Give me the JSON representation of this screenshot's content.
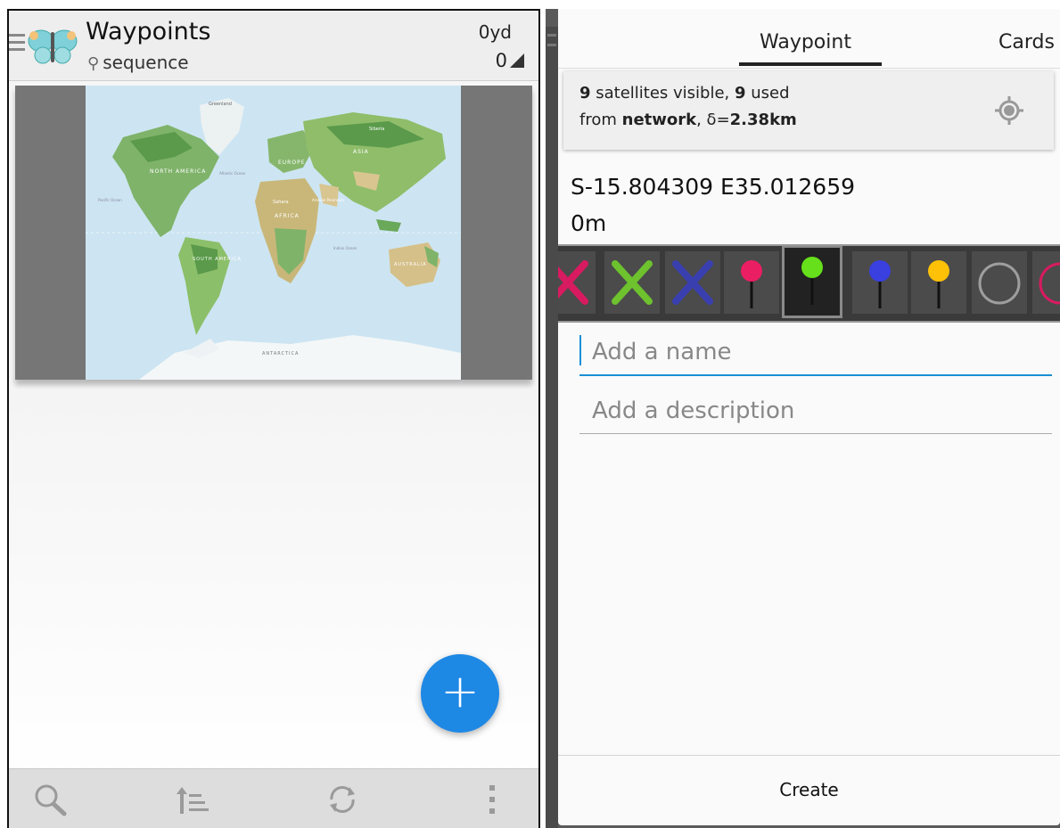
{
  "left": {
    "app_title": "Waypoints",
    "subtitle": "sequence",
    "distance": "0yd",
    "count": "0",
    "map_labels": {
      "greenland": "Greenland",
      "north_america": "NORTH AMERICA",
      "europe": "EUROPE",
      "asia": "ASIA",
      "africa": "AFRICA",
      "south_america": "SOUTH AMERICA",
      "australia": "AUSTRALIA",
      "antarctica": "ANTARCTICA",
      "sahara": "Sahara",
      "siberia": "Siberia",
      "arabian": "Arabian Peninsula",
      "atlantic": "Atlantic Ocean",
      "indian": "Indian Ocean",
      "pacific": "Pacific Ocean"
    },
    "fab_icon": "plus-icon",
    "bottom_icons": [
      "search-icon",
      "sort-icon",
      "refresh-icon",
      "overflow-menu-icon"
    ],
    "fab_color": "#1e88e5"
  },
  "dialog": {
    "tabs": [
      "Waypoint",
      "Cards"
    ],
    "active_tab": "Waypoint",
    "gps_count_visible": "9",
    "gps_text_visible": " satellites visible, ",
    "gps_count_used": "9",
    "gps_text_used": " used",
    "gps_from": "from ",
    "gps_source": "network",
    "gps_delta_label": ", δ=",
    "gps_delta_value": "2.38km",
    "coordinates": "S-15.804309 E35.012659",
    "altitude": "0m",
    "icon_options": [
      {
        "name": "red-cross-icon",
        "color": "#d81b60"
      },
      {
        "name": "green-cross-icon",
        "color": "#6dc22e"
      },
      {
        "name": "blue-cross-icon",
        "color": "#3a3fb0"
      },
      {
        "name": "pink-pin-icon",
        "color": "#e91e63"
      },
      {
        "name": "green-pin-icon",
        "color": "#66e01a",
        "selected": true
      },
      {
        "name": "blue-pin-icon",
        "color": "#3a3fe0"
      },
      {
        "name": "yellow-pin-icon",
        "color": "#ffc107"
      },
      {
        "name": "gray-circle-icon",
        "color": "#9e9e9e"
      },
      {
        "name": "red-circle-icon",
        "color": "#d81b60"
      }
    ],
    "name_placeholder": "Add a name",
    "description_placeholder": "Add a description",
    "create_label": "Create",
    "accent_color": "#1a8fd6"
  }
}
